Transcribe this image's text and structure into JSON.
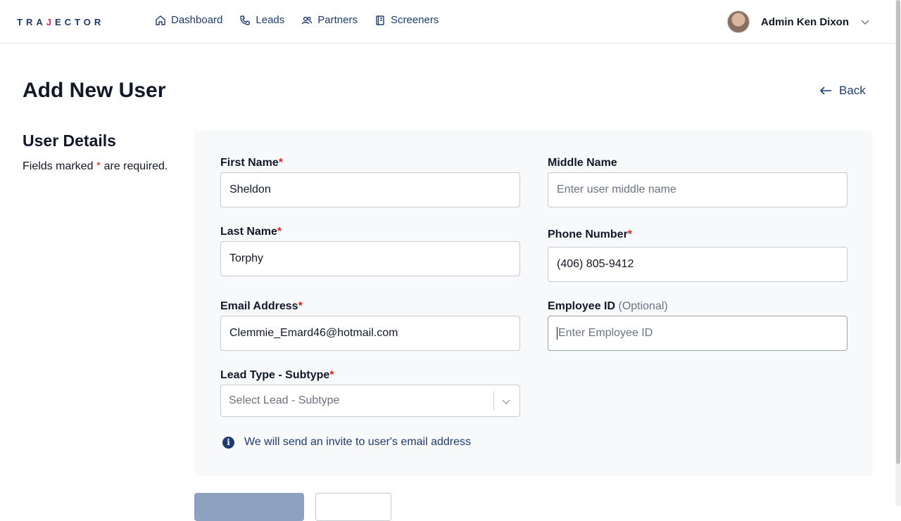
{
  "header": {
    "logo_left": "TRA",
    "logo_accent": "J",
    "logo_right": "ECTOR",
    "nav": [
      {
        "label": "Dashboard",
        "icon": "home-icon"
      },
      {
        "label": "Leads",
        "icon": "phone-icon"
      },
      {
        "label": "Partners",
        "icon": "users-icon"
      },
      {
        "label": "Screeners",
        "icon": "document-icon"
      }
    ],
    "user_name": "Admin Ken Dixon"
  },
  "page": {
    "title": "Add New User",
    "back_label": "Back"
  },
  "section": {
    "title": "User Details",
    "note_prefix": "Fields marked ",
    "note_star": "*",
    "note_suffix": " are required."
  },
  "form": {
    "first_name": {
      "label": "First Name",
      "required": "*",
      "value": "Sheldon"
    },
    "middle_name": {
      "label": "Middle Name",
      "placeholder": "Enter user middle name"
    },
    "last_name": {
      "label": "Last Name",
      "required": "*",
      "value": "Torphy"
    },
    "phone": {
      "label": "Phone Number",
      "required": "*",
      "value": "(406) 805-9412"
    },
    "email": {
      "label": "Email Address",
      "required": "*",
      "value": "Clemmie_Emard46@hotmail.com"
    },
    "employee_id": {
      "label": "Employee ID",
      "optional": "(Optional)",
      "placeholder": "Enter Employee ID"
    },
    "lead_type": {
      "label": "Lead Type - Subtype",
      "required": "*",
      "placeholder": "Select Lead - Subtype"
    },
    "info_text": "We will send an invite to user's email address"
  },
  "colors": {
    "brand": "#1e3a6e",
    "required": "#dc2626"
  }
}
